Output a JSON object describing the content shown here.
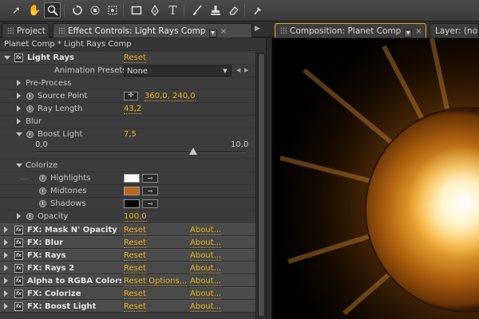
{
  "tabs": {
    "project": "Project",
    "effect_controls": "Effect Controls: Light Rays Comp",
    "composition": "Composition: Planet Comp",
    "layer": "Layer: (no"
  },
  "breadcrumb": "Planet Comp * Light Rays Comp",
  "light_rays": {
    "name": "Light Rays",
    "reset": "Reset",
    "presets_label": "Animation Presets:",
    "presets_value": "None",
    "pre_process": "Pre-Process",
    "source_point_label": "Source Point",
    "source_point_value": "360,0, 240,0",
    "ray_length_label": "Ray Length",
    "ray_length_value": "43,2",
    "blur": "Blur",
    "boost_light_label": "Boost Light",
    "boost_light_value": "7,5",
    "slider_min": "0,0",
    "slider_max": "10,0",
    "slider_fraction": 0.75,
    "colorize": "Colorize",
    "highlights": "Highlights",
    "midtones": "Midtones",
    "shadows": "Shadows",
    "opacity_label": "Opacity",
    "opacity_value": "100,0"
  },
  "colors": {
    "highlights": "#ffffff",
    "midtones": "#c0651d",
    "shadows": "#050505"
  },
  "effects": [
    {
      "name": "FX: Mask N' Opacity",
      "reset": "Reset",
      "about": "About..."
    },
    {
      "name": "FX: Blur",
      "reset": "Reset",
      "about": "About..."
    },
    {
      "name": "FX: Rays",
      "reset": "Reset",
      "about": "About..."
    },
    {
      "name": "FX: Rays 2",
      "reset": "Reset",
      "about": "About..."
    },
    {
      "name": "Alpha to RGBA Colors (",
      "reset": "Reset Options...",
      "about": "About..."
    },
    {
      "name": "FX: Colorize",
      "reset": "Reset",
      "about": "About..."
    },
    {
      "name": "FX: Boost Light",
      "reset": "Reset",
      "about": "About..."
    }
  ],
  "icons": [
    "selection-tool-icon",
    "hand-tool-icon",
    "zoom-tool-icon",
    "rotate-tool-icon",
    "orbit-camera-icon",
    "pan-behind-icon",
    "rectangle-mask-icon",
    "pen-tool-icon",
    "text-tool-icon",
    "brush-tool-icon",
    "clone-stamp-icon",
    "eraser-icon",
    "puppet-pin-icon"
  ]
}
